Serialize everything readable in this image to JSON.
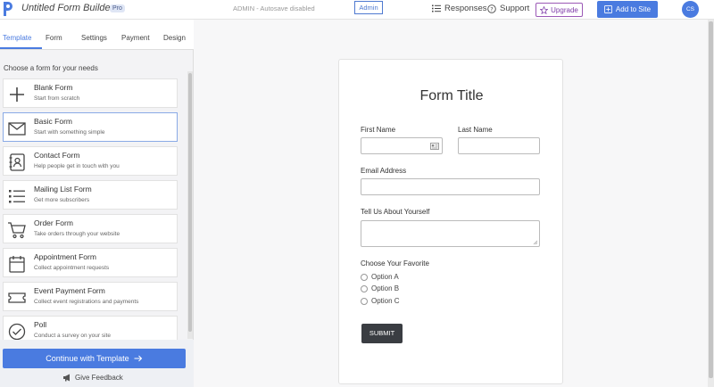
{
  "header": {
    "app_title": "Untitled Form Builder",
    "badge": "Pro",
    "autosave": "ADMIN - Autosave disabled",
    "admin_label": "Admin",
    "responses_label": "Responses",
    "support_label": "Support",
    "upgrade_label": "Upgrade",
    "add_to_site_label": "Add to Site",
    "avatar_initials": "CS"
  },
  "sidebar": {
    "tabs": [
      "Template",
      "Form",
      "Settings",
      "Payment",
      "Design"
    ],
    "choose_text": "Choose a form for your needs",
    "templates": [
      {
        "title": "Blank Form",
        "subtitle": "Start from scratch",
        "icon": "plus-icon"
      },
      {
        "title": "Basic Form",
        "subtitle": "Start with something simple",
        "icon": "envelope-icon"
      },
      {
        "title": "Contact Form",
        "subtitle": "Help people get in touch with you",
        "icon": "contact-book-icon"
      },
      {
        "title": "Mailing List Form",
        "subtitle": "Get more subscribers",
        "icon": "list-icon"
      },
      {
        "title": "Order Form",
        "subtitle": "Take orders through your website",
        "icon": "cart-icon"
      },
      {
        "title": "Appointment Form",
        "subtitle": "Collect appointment requests",
        "icon": "calendar-icon"
      },
      {
        "title": "Event Payment Form",
        "subtitle": "Collect event registrations and payments",
        "icon": "ticket-icon"
      },
      {
        "title": "Poll",
        "subtitle": "Conduct a survey on your site",
        "icon": "check-circle-icon"
      }
    ],
    "continue_label": "Continue with Template",
    "feedback_label": "Give Feedback"
  },
  "form": {
    "title": "Form Title",
    "first_name_label": "First Name",
    "last_name_label": "Last Name",
    "email_label": "Email Address",
    "about_label": "Tell Us About Yourself",
    "favorite_label": "Choose Your Favorite",
    "options": [
      "Option A",
      "Option B",
      "Option C"
    ],
    "submit_label": "SUBMIT"
  },
  "colors": {
    "accent": "#4a7be0",
    "upgrade": "#9b59b6",
    "submit": "#3a3d42"
  }
}
